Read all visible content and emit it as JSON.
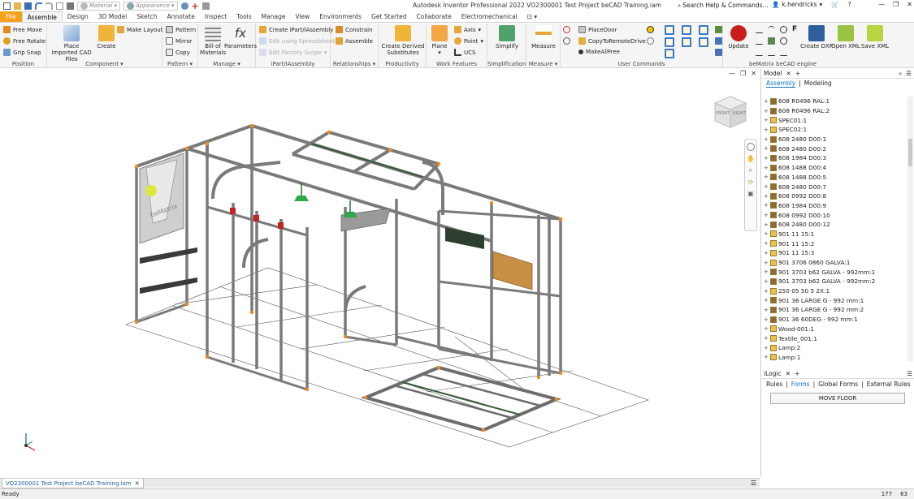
{
  "window": {
    "title": "Autodesk Inventor Professional 2022    VO2300001 Test Project beCAD Training.iam",
    "help_search": "Search Help & Commands...",
    "user": "k.hendricks"
  },
  "quick_access": {
    "material": "Material",
    "appearance": "Appearance"
  },
  "tabs": [
    "File",
    "Assemble",
    "Design",
    "3D Model",
    "Sketch",
    "Annotate",
    "Inspect",
    "Tools",
    "Manage",
    "View",
    "Environments",
    "Get Started",
    "Collaborate",
    "Electromechanical"
  ],
  "ribbon": {
    "position": {
      "free_move": "Free Move",
      "free_rotate": "Free Rotate",
      "grip_snap": "Grip Snap",
      "label": "Position"
    },
    "component": {
      "place_imported": "Place Imported CAD Files",
      "create": "Create",
      "make_layout": "Make Layout",
      "label": "Component"
    },
    "pattern": {
      "pattern": "Pattern",
      "mirror": "Mirror",
      "copy": "Copy",
      "label": "Pattern"
    },
    "manage": {
      "bom": "Bill of Materials",
      "parameters": "Parameters",
      "label": "Manage"
    },
    "ipart": {
      "create": "Create iPart/iAssembly",
      "spreadsheet": "Edit using Spreadsheet",
      "factory": "Edit Factory Scope",
      "label": "iPart/iAssembly"
    },
    "relationships": {
      "constrain": "Constrain",
      "assemble": "Assemble",
      "label": "Relationships"
    },
    "productivity": {
      "derived": "Create Derived Substitutes",
      "label": "Productivity"
    },
    "work_features": {
      "plane": "Plane",
      "axis": "Axis",
      "point": "Point",
      "ucs": "UCS",
      "label": "Work Features"
    },
    "simplification": {
      "simplify": "Simplify",
      "label": "Simplification"
    },
    "measure": {
      "measure": "Measure",
      "label": "Measure"
    },
    "user_commands": {
      "place_door": "PlaceDoor",
      "copy_remote": "CopyToRemoteDrive",
      "make_all_free": "MakeAllFree",
      "label": "User Commands"
    },
    "bematrix": {
      "update": "Update",
      "create_dxf": "Create DXF",
      "open_xml": "Open XML",
      "save_xml": "Save XML",
      "label": "beMatrix beCAD engine"
    }
  },
  "model_panel": {
    "title": "Model",
    "subtabs": [
      "Assembly",
      "Modeling"
    ],
    "tree": [
      "608 R0496 RAL:1",
      "608 R0496 RAL:2",
      "SPEC01:1",
      "SPEC02:1",
      "608 2480 D00:1",
      "608 2480 D00:2",
      "608 1984 D00:3",
      "608 1488 D00:4",
      "608 1488 D00:5",
      "608 2480 D00:7",
      "608 0992 D00:8",
      "608 1984 D00:9",
      "608 0992 D00:10",
      "608 2480 D00:12",
      "901 11 15:1",
      "901 11 15:2",
      "901 11 15:3",
      "901 3706 0860 GALVA:1",
      "901 3703 b62 GALVA - 992mm:1",
      "901 3703 b62 GALVA - 992mm:2",
      "250 05 50 5 2X:1",
      "901 36 LARGE G - 992 mm:1",
      "901 36 LARGE G - 992 mm:2",
      "901 36 60DEG - 992 mm:1",
      "Wood-001:1",
      "Textile_001:1",
      "Lamp:2",
      "Lamp:1"
    ]
  },
  "logic_panel": {
    "title": "iLogic",
    "tabs": [
      "Rules",
      "Forms",
      "Global Forms",
      "External Rules"
    ],
    "button": "MOVE FLOOR"
  },
  "viewcube": {
    "front": "FRONT",
    "right": "RIGHT"
  },
  "graphic_text": {
    "brand": "beMatrix"
  },
  "document_tab": "VO2300001 Test Project beCAD Training.iam",
  "status": {
    "text": "Ready",
    "num1": "177",
    "num2": "63"
  },
  "colors": {
    "file_tab": "#f4a21d",
    "frame": "#8c8c8c",
    "connector": "#f08a1c",
    "lamp": "#2fa84a",
    "wood": "#c89044",
    "accent": "#0b6fc2"
  }
}
